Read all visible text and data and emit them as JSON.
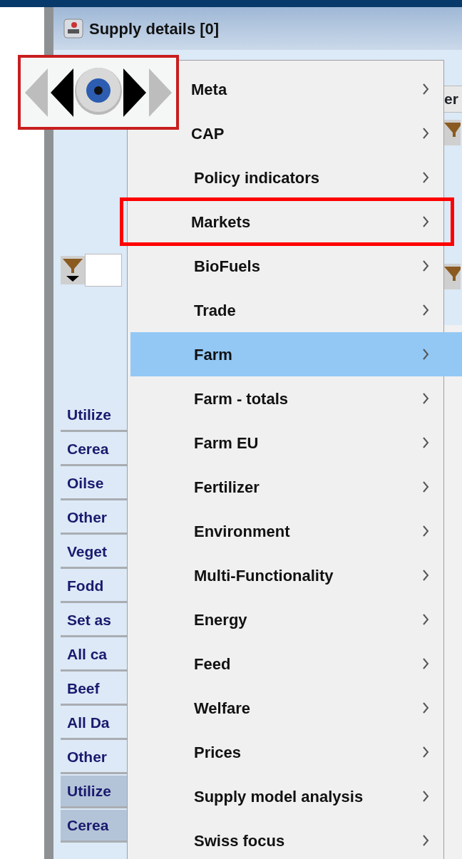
{
  "window": {
    "title": "Supply details [0]"
  },
  "nav_widget": {
    "highlighted": true
  },
  "column_header": "er",
  "table_rows": [
    {
      "label": "Utilize",
      "selected": false
    },
    {
      "label": "Cerea",
      "selected": false
    },
    {
      "label": "Oilse",
      "selected": false
    },
    {
      "label": "Other",
      "selected": false
    },
    {
      "label": "Veget",
      "selected": false
    },
    {
      "label": "Fodd",
      "selected": false
    },
    {
      "label": "Set as",
      "selected": false
    },
    {
      "label": "All ca",
      "selected": false
    },
    {
      "label": "Beef",
      "selected": false
    },
    {
      "label": "All Da",
      "selected": false
    },
    {
      "label": "Other",
      "selected": false
    },
    {
      "label": "Utilize",
      "selected": true
    },
    {
      "label": "Cerea",
      "selected": true
    }
  ],
  "menu": {
    "items": [
      {
        "label": "Meta",
        "selected": false,
        "highlighted": false,
        "submenu": true
      },
      {
        "label": "CAP",
        "selected": false,
        "highlighted": false,
        "submenu": true
      },
      {
        "label": "Policy indicators",
        "selected": false,
        "highlighted": false,
        "submenu": true
      },
      {
        "label": "Markets",
        "selected": false,
        "highlighted": true,
        "submenu": true
      },
      {
        "label": "BioFuels",
        "selected": false,
        "highlighted": false,
        "submenu": true
      },
      {
        "label": "Trade",
        "selected": false,
        "highlighted": false,
        "submenu": true
      },
      {
        "label": "Farm",
        "selected": true,
        "highlighted": false,
        "submenu": true
      },
      {
        "label": "Farm - totals",
        "selected": false,
        "highlighted": false,
        "submenu": true
      },
      {
        "label": "Farm EU",
        "selected": false,
        "highlighted": false,
        "submenu": true
      },
      {
        "label": "Fertilizer",
        "selected": false,
        "highlighted": false,
        "submenu": true
      },
      {
        "label": "Environment",
        "selected": false,
        "highlighted": false,
        "submenu": true
      },
      {
        "label": "Multi-Functionality",
        "selected": false,
        "highlighted": false,
        "submenu": true
      },
      {
        "label": "Energy",
        "selected": false,
        "highlighted": false,
        "submenu": true
      },
      {
        "label": "Feed",
        "selected": false,
        "highlighted": false,
        "submenu": true
      },
      {
        "label": "Welfare",
        "selected": false,
        "highlighted": false,
        "submenu": true
      },
      {
        "label": "Prices",
        "selected": false,
        "highlighted": false,
        "submenu": true
      },
      {
        "label": "Supply model analysis",
        "selected": false,
        "highlighted": false,
        "submenu": true
      },
      {
        "label": "Swiss focus",
        "selected": false,
        "highlighted": false,
        "submenu": true
      }
    ]
  }
}
